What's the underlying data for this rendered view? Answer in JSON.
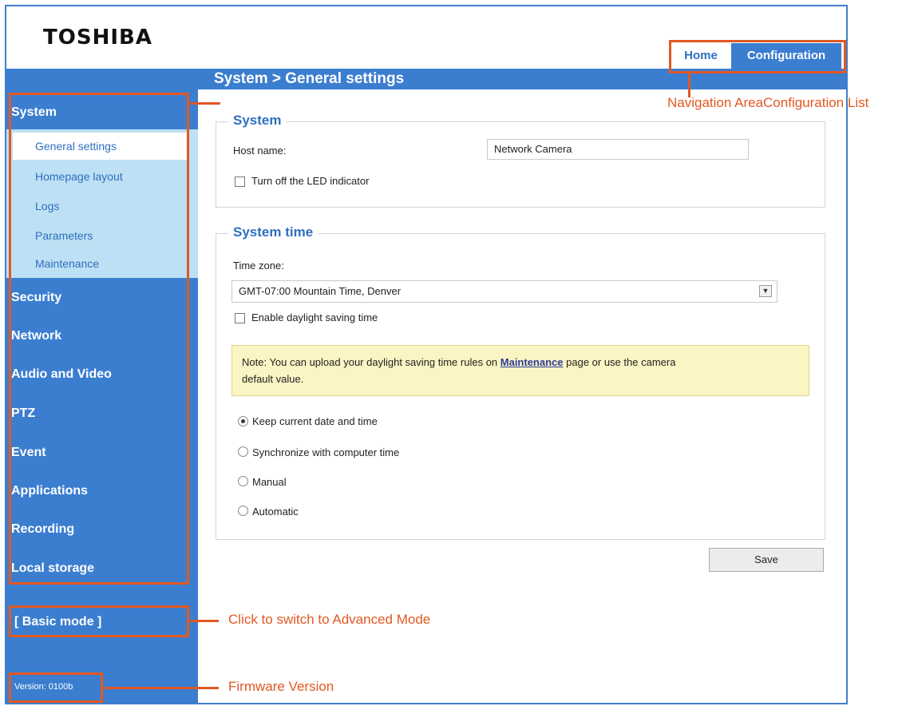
{
  "brand": {
    "logo": "TOSHIBA"
  },
  "top_nav": {
    "home": "Home",
    "configuration": "Configuration"
  },
  "breadcrumb": "System  > General settings",
  "sidebar": {
    "categories": [
      "System",
      "Security",
      "Network",
      "Audio and Video",
      "PTZ",
      "Event",
      "Applications",
      "Recording",
      "Local storage"
    ],
    "system_sub_items": [
      "General settings",
      "Homepage layout",
      "Logs",
      "Parameters",
      "Maintenance"
    ],
    "selected_sub_item": "General settings",
    "mode_toggle": "[ Basic mode ]",
    "version": "Version: 0100b"
  },
  "system_section": {
    "legend": "System",
    "host_name_label": "Host name:",
    "host_name_value": "Network Camera",
    "led_checkbox_label": "Turn off the LED indicator",
    "led_checkbox_checked": false
  },
  "system_time_section": {
    "legend": "System time",
    "time_zone_label": "Time zone:",
    "time_zone_value": "GMT-07:00 Mountain Time, Denver",
    "daylight_label": "Enable daylight saving time",
    "daylight_checked": false,
    "note_prefix": "Note: You can upload your daylight saving time rules on ",
    "note_link": "Maintenance",
    "note_suffix_line1": " page or use the camera",
    "note_line2": "default value.",
    "radio_options": [
      "Keep current date and time",
      "Synchronize with computer time",
      "Manual",
      "Automatic"
    ],
    "selected_radio": "Keep current date and time"
  },
  "save_button": "Save",
  "annotations": {
    "navigation_area": "Navigation AreaConfiguration List",
    "advanced_mode": "Click to switch to Advanced Mode",
    "firmware_version": "Firmware Version"
  },
  "colors": {
    "accent": "#3b7ed0",
    "annotation": "#e25822",
    "note_bg": "#fbf4c3"
  }
}
